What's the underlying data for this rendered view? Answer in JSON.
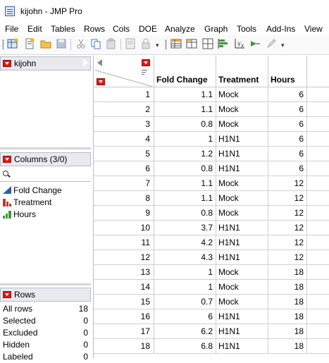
{
  "window": {
    "title": "kijohn - JMP Pro"
  },
  "menu": [
    "File",
    "Edit",
    "Tables",
    "Rows",
    "Cols",
    "DOE",
    "Analyze",
    "Graph",
    "Tools",
    "Add-Ins",
    "View"
  ],
  "table_panel": {
    "name": "kijohn"
  },
  "columns_panel": {
    "title": "Columns (3/0)",
    "items": [
      {
        "label": "Fold Change",
        "icon": "continuous-icon"
      },
      {
        "label": "Treatment",
        "icon": "nominal-icon"
      },
      {
        "label": "Hours",
        "icon": "ordinal-icon"
      }
    ]
  },
  "rows_panel": {
    "title": "Rows",
    "stats": [
      {
        "label": "All rows",
        "value": "18"
      },
      {
        "label": "Selected",
        "value": "0"
      },
      {
        "label": "Excluded",
        "value": "0"
      },
      {
        "label": "Hidden",
        "value": "0"
      },
      {
        "label": "Labeled",
        "value": "0"
      }
    ]
  },
  "grid": {
    "headers": [
      "Fold Change",
      "Treatment",
      "Hours"
    ],
    "rows": [
      [
        "1",
        "1.1",
        "Mock",
        "6"
      ],
      [
        "2",
        "1.1",
        "Mock",
        "6"
      ],
      [
        "3",
        "0.8",
        "Mock",
        "6"
      ],
      [
        "4",
        "1",
        "H1N1",
        "6"
      ],
      [
        "5",
        "1.2",
        "H1N1",
        "6"
      ],
      [
        "6",
        "0.8",
        "H1N1",
        "6"
      ],
      [
        "7",
        "1.1",
        "Mock",
        "12"
      ],
      [
        "8",
        "1.1",
        "Mock",
        "12"
      ],
      [
        "9",
        "0.8",
        "Mock",
        "12"
      ],
      [
        "10",
        "3.7",
        "H1N1",
        "12"
      ],
      [
        "11",
        "4.2",
        "H1N1",
        "12"
      ],
      [
        "12",
        "4.3",
        "H1N1",
        "12"
      ],
      [
        "13",
        "1",
        "Mock",
        "18"
      ],
      [
        "14",
        "1",
        "Mock",
        "18"
      ],
      [
        "15",
        "0.7",
        "Mock",
        "18"
      ],
      [
        "16",
        "6",
        "H1N1",
        "18"
      ],
      [
        "17",
        "6.2",
        "H1N1",
        "18"
      ],
      [
        "18",
        "6.8",
        "H1N1",
        "18"
      ]
    ]
  },
  "colors": {
    "red_button": "#e01818",
    "panel_header": "#e8eaee",
    "continuous": "#2a5db0",
    "nominal": "#c0392b",
    "ordinal": "#3c9a3c"
  }
}
